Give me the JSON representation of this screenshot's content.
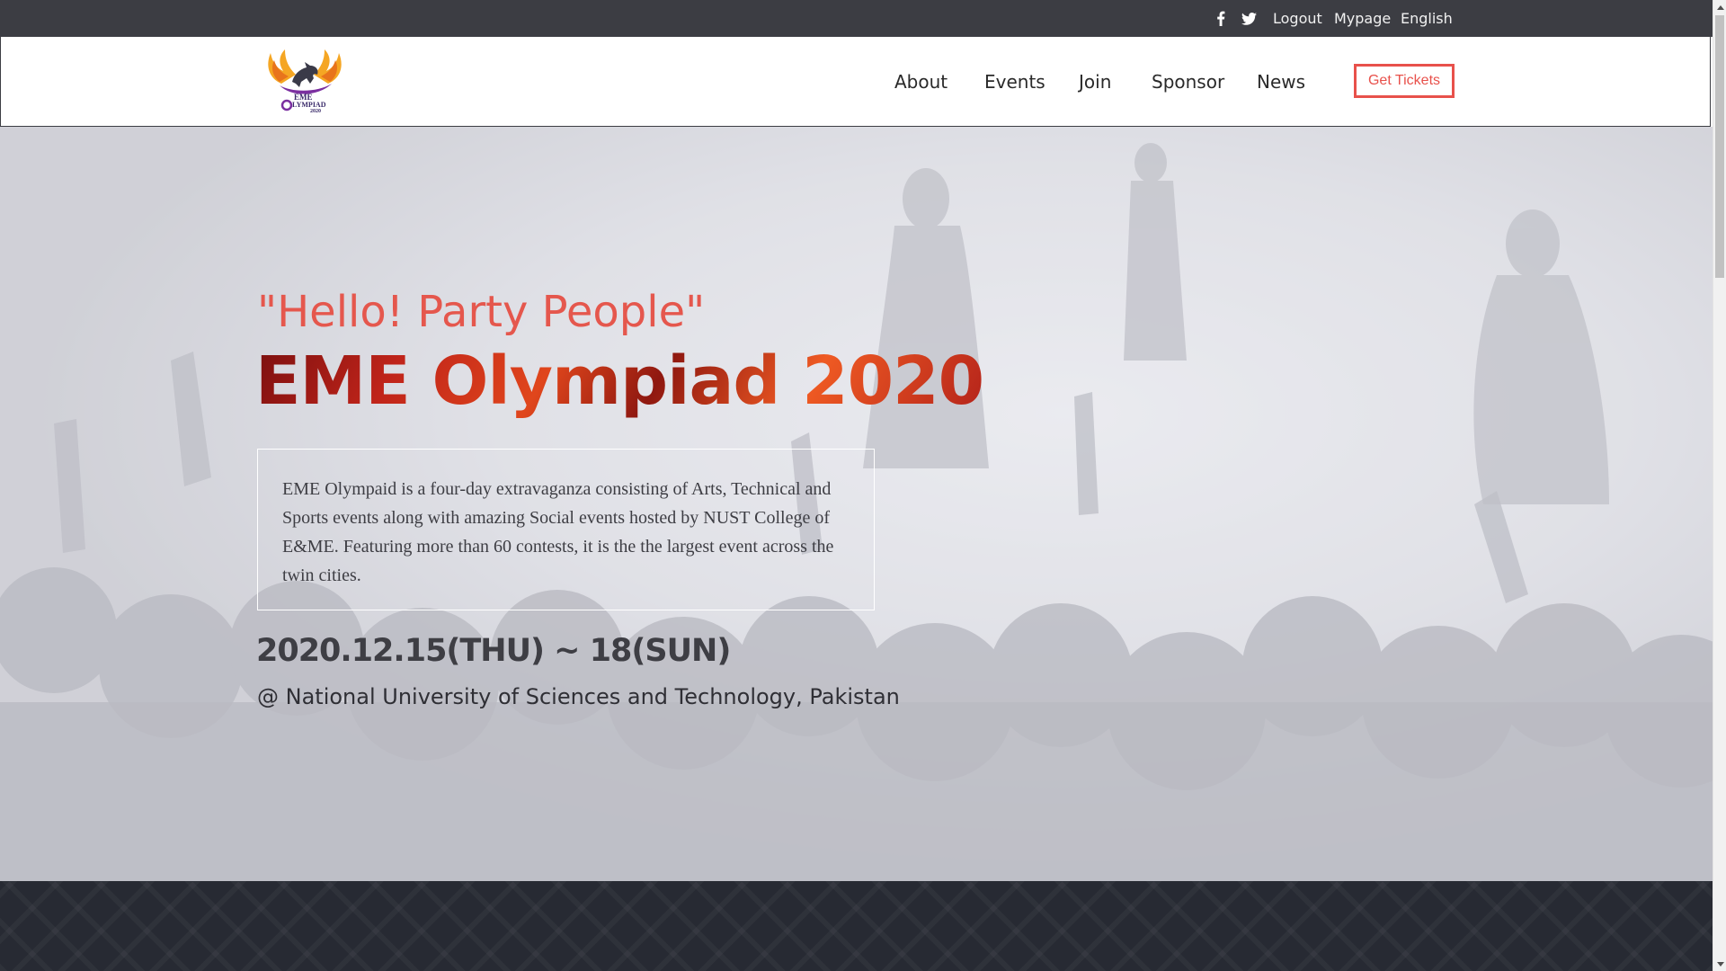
{
  "topbar": {
    "facebook_icon": "facebook-icon",
    "twitter_icon": "twitter-icon",
    "logout": "Logout",
    "mypage": "Mypage",
    "language": "English"
  },
  "nav": {
    "logo_icon": "eme-olympiad-2020-logo",
    "items": [
      "About",
      "Events",
      "Join",
      "Sponsor",
      "News"
    ],
    "tickets": "Get Tickets"
  },
  "hero": {
    "tagline": "\"Hello! Party People\"",
    "title": "EME Olympiad 2020",
    "description": "EME Olympaid is a four-day extravaganza consisting of Arts, Technical and Sports events along with amazing Social events hosted by NUST College of E&ME. Featuring more than 60 contests, it is the the largest event across the twin cities.",
    "dates": "2020.12.15(THU) ~ 18(SUN)",
    "venue": "@ National University of Sciences and Technology, Pakistan"
  },
  "colors": {
    "topbar_bg": "#3c3d43",
    "accent": "#e8514b",
    "hero_overlay": "#d6d6dc",
    "band_bg": "#272a33"
  }
}
